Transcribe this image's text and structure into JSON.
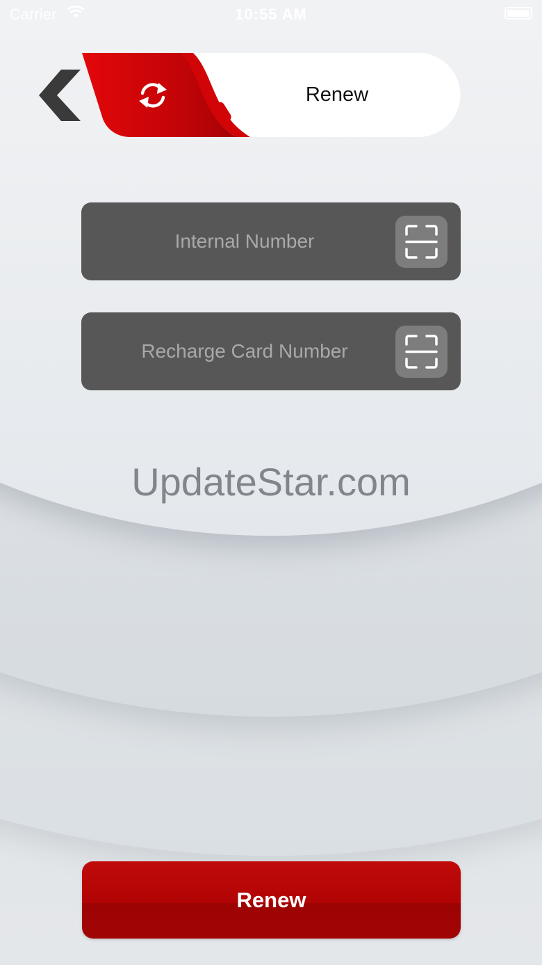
{
  "status_bar": {
    "carrier": "Carrier",
    "time": "10:55 AM"
  },
  "header": {
    "title": "Renew",
    "back_icon": "chevron-left-icon",
    "header_icon": "refresh-icon"
  },
  "fields": {
    "internal_number": {
      "placeholder": "Internal Number",
      "icon": "scan-icon"
    },
    "recharge_card_number": {
      "placeholder": "Recharge Card Number",
      "icon": "scan-icon"
    }
  },
  "watermark": "UpdateStar.com",
  "actions": {
    "renew_label": "Renew"
  },
  "colors": {
    "accent": "#c00a0a",
    "field_bg": "#575757",
    "scan_bg": "#7d7d7d"
  }
}
